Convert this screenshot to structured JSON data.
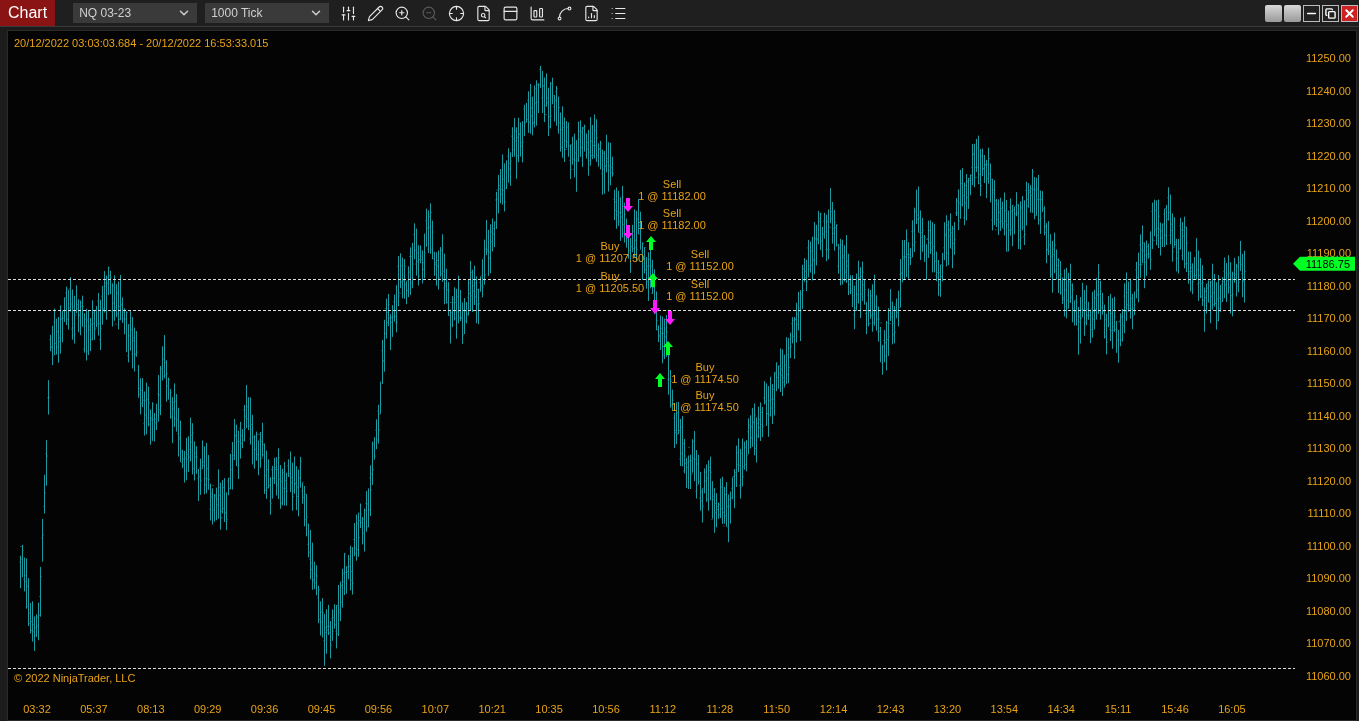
{
  "window": {
    "title": "Chart"
  },
  "instrument": {
    "value": "NQ 03-23"
  },
  "interval": {
    "value": "1000 Tick"
  },
  "toolbar": [
    {
      "kind": "properties",
      "disabled": false
    },
    {
      "kind": "draw",
      "disabled": false
    },
    {
      "kind": "zoom-in",
      "disabled": false
    },
    {
      "kind": "zoom-out",
      "disabled": true
    },
    {
      "kind": "crosshair",
      "disabled": false
    },
    {
      "kind": "data-box",
      "disabled": false
    },
    {
      "kind": "chart-trader",
      "disabled": false
    },
    {
      "kind": "bars",
      "disabled": false
    },
    {
      "kind": "strategies",
      "disabled": false
    },
    {
      "kind": "templates",
      "disabled": false
    },
    {
      "kind": "list",
      "disabled": false
    }
  ],
  "chart": {
    "date_range": "20/12/2022 03:03:03.684 - 20/12/2022 16:53:33.015",
    "copyright": "© 2022 NinjaTrader, LLC",
    "last_price": "11186.75",
    "price_axis": [
      "11250.00",
      "11240.00",
      "11230.00",
      "11220.00",
      "11210.00",
      "11200.00",
      "11190.00",
      "11180.00",
      "11170.00",
      "11160.00",
      "11150.00",
      "11140.00",
      "11130.00",
      "11120.00",
      "11110.00",
      "11100.00",
      "11090.00",
      "11080.00",
      "11070.00",
      "11060.00"
    ],
    "time_axis": [
      "03:32",
      "05:37",
      "08:13",
      "09:29",
      "09:36",
      "09:45",
      "09:56",
      "10:07",
      "10:21",
      "10:35",
      "10:56",
      "11:12",
      "11:28",
      "11:50",
      "12:14",
      "12:43",
      "13:20",
      "13:54",
      "14:34",
      "15:11",
      "15:46",
      "16:05"
    ],
    "trades": [
      {
        "kind": "sell",
        "action": "Sell",
        "detail": "1 @ 11182.00"
      },
      {
        "kind": "sell",
        "action": "Sell",
        "detail": "1 @ 11182.00"
      },
      {
        "kind": "buy",
        "action": "Buy",
        "detail": "1 @ 11207.50"
      },
      {
        "kind": "sell",
        "action": "Sell",
        "detail": "1 @ 11152.00"
      },
      {
        "kind": "buy",
        "action": "Buy",
        "detail": "1 @ 11205.50"
      },
      {
        "kind": "sell",
        "action": "Sell",
        "detail": "1 @ 11152.00"
      },
      {
        "kind": "buy",
        "action": "Buy",
        "detail": "1 @ 11174.50"
      },
      {
        "kind": "buy",
        "action": "Buy",
        "detail": "1 @ 11174.50"
      }
    ]
  }
}
